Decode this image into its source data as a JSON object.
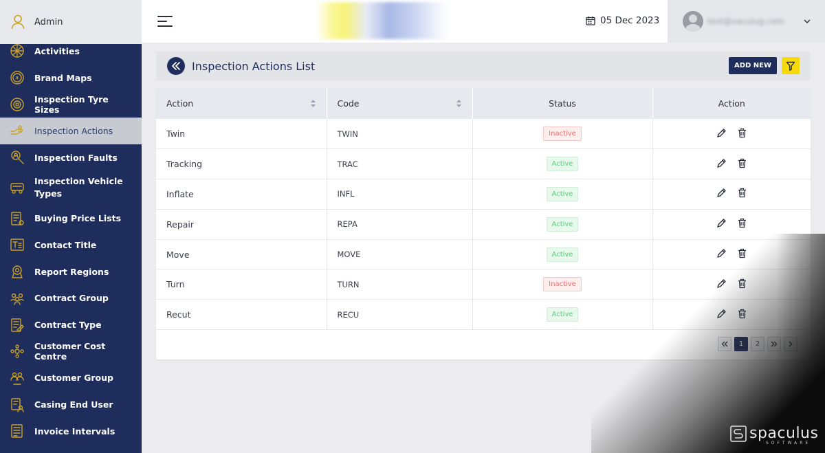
{
  "sidebar": {
    "admin_label": "Admin",
    "items": [
      {
        "label": "Activities",
        "icon": "activities-icon"
      },
      {
        "label": "Brand Maps",
        "icon": "brand-icon"
      },
      {
        "label": "Inspection Tyre Sizes",
        "icon": "tyre-icon"
      },
      {
        "label": "Inspection Actions",
        "icon": "hand-icon",
        "active": true
      },
      {
        "label": "Inspection Faults",
        "icon": "search-person-icon"
      },
      {
        "label": "Inspection Vehicle Types",
        "icon": "vehicle-icon"
      },
      {
        "label": "Buying Price Lists",
        "icon": "price-list-icon"
      },
      {
        "label": "Contact Title",
        "icon": "title-icon"
      },
      {
        "label": "Report Regions",
        "icon": "region-icon"
      },
      {
        "label": "Contract Group",
        "icon": "group-icon"
      },
      {
        "label": "Contract Type",
        "icon": "contract-icon"
      },
      {
        "label": "Customer Cost Centre",
        "icon": "cost-centre-icon"
      },
      {
        "label": "Customer Group",
        "icon": "customer-group-icon"
      },
      {
        "label": "Casing End User",
        "icon": "end-user-icon"
      },
      {
        "label": "Invoice Intervals",
        "icon": "invoice-icon"
      }
    ]
  },
  "header": {
    "date": "05 Dec 2023",
    "user_email": "test@vaculug.com"
  },
  "page": {
    "title": "Inspection Actions List",
    "add_new_label": "ADD NEW"
  },
  "table": {
    "headers": {
      "action": "Action",
      "code": "Code",
      "status": "Status",
      "actions": "Action"
    },
    "rows": [
      {
        "action": "Twin",
        "code": "TWIN",
        "status": "Inactive"
      },
      {
        "action": "Tracking",
        "code": "TRAC",
        "status": "Active"
      },
      {
        "action": "Inflate",
        "code": "INFL",
        "status": "Active"
      },
      {
        "action": "Repair",
        "code": "REPA",
        "status": "Active"
      },
      {
        "action": "Move",
        "code": "MOVE",
        "status": "Active"
      },
      {
        "action": "Turn",
        "code": "TURN",
        "status": "Inactive"
      },
      {
        "action": "Recut",
        "code": "RECU",
        "status": "Active"
      }
    ]
  },
  "pagination": {
    "pages": [
      "1",
      "2"
    ],
    "current": "1"
  },
  "watermark": {
    "name": "spaculus",
    "sub": "SOFTWARE"
  },
  "colors": {
    "navy": "#1f2d5c",
    "accent": "#f5d90a",
    "active": "#5ecb7b",
    "inactive": "#ec6e6e"
  }
}
